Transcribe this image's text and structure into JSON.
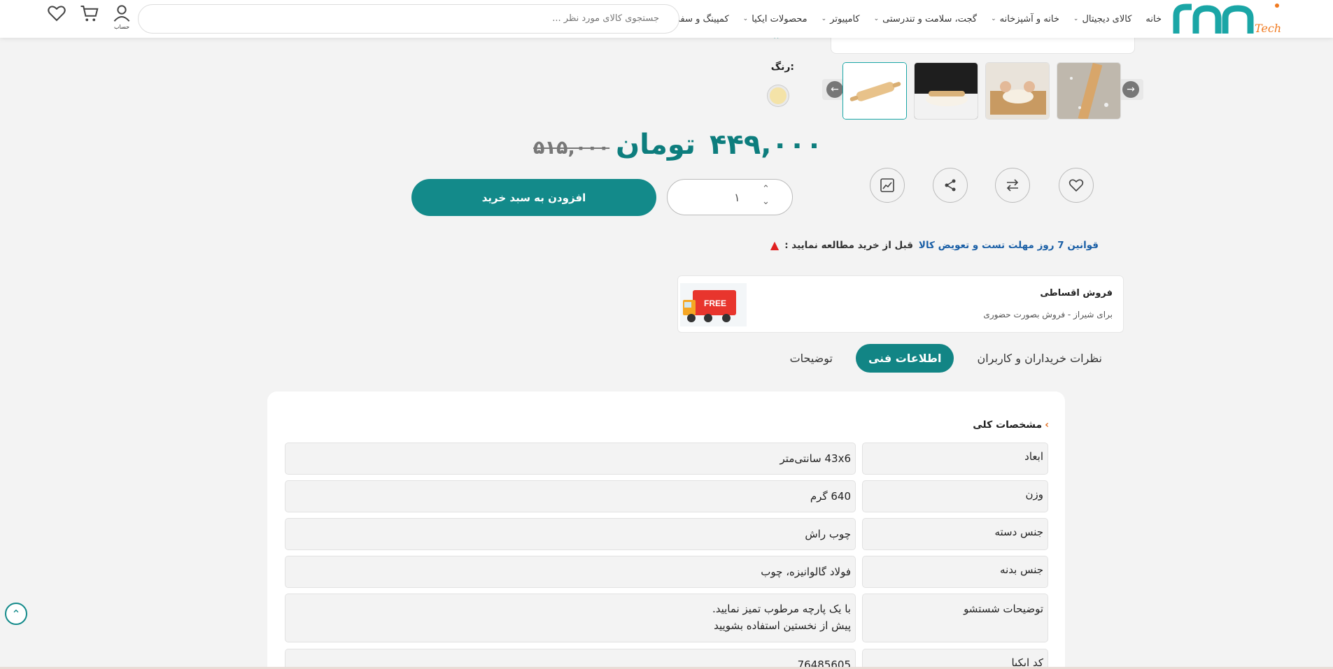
{
  "header": {
    "nav": [
      {
        "label": "خانه",
        "has_dropdown": false
      },
      {
        "label": "کالای دیجیتال",
        "has_dropdown": true
      },
      {
        "label": "خانه و آشپزخانه",
        "has_dropdown": true
      },
      {
        "label": "گجت، سلامت و تندرستی",
        "has_dropdown": true
      },
      {
        "label": "کامپیوتر",
        "has_dropdown": true
      },
      {
        "label": "محصولات ایکیا",
        "has_dropdown": true
      },
      {
        "label": "کمپینگ و سفر",
        "has_dropdown": true
      }
    ],
    "search_placeholder": "جستجوی کالای مورد نظر ...",
    "account_caption": "حساب",
    "icons": [
      "user-icon",
      "cart-icon",
      "heart-icon"
    ]
  },
  "product": {
    "color_label": "رنگ:",
    "color_value": "#f4e3a8",
    "price": "۴۴۹,۰۰۰",
    "currency": "تومان",
    "old_price": "۵۱۵,۰۰۰",
    "quantity": "۱",
    "add_to_cart": "افزودن به سبد خرید"
  },
  "notice": {
    "text": "قبل از خرید مطالعه نمایید :",
    "link": "قوانین 7 روز مهلت تست و تعویض کالا"
  },
  "installment": {
    "title": "فروش اقساطی",
    "subtitle": "برای شیراز - فروش بصورت حضوری",
    "badge": "FREE"
  },
  "tabs": [
    {
      "label": "توضیحات",
      "active": false
    },
    {
      "label": "اطلاعات فنی",
      "active": true
    },
    {
      "label": "نظرات خریداران و کاربران",
      "active": false
    }
  ],
  "specs": {
    "title": "مشخصات کلی",
    "rows": [
      {
        "key": "ابعاد",
        "value": "43x6 سانتی‌متر"
      },
      {
        "key": "وزن",
        "value": "640 گرم"
      },
      {
        "key": "جنس دسته",
        "value": "چوب راش"
      },
      {
        "key": "جنس بدنه",
        "value": "فولاد گالوانیزه، چوب"
      },
      {
        "key": "توضیحات شستشو",
        "value": "با یک پارچه مرطوب تمیز نمایید.\nپیش از نخستین استفاده بشویید"
      },
      {
        "key": "کد ایکیا",
        "value": "76485605"
      }
    ]
  },
  "colors": {
    "accent": "#138a8a",
    "logo_teal": "#1aa6a6",
    "logo_orange": "#f07a20",
    "warning": "#e02020",
    "link": "#1a5fa6"
  }
}
